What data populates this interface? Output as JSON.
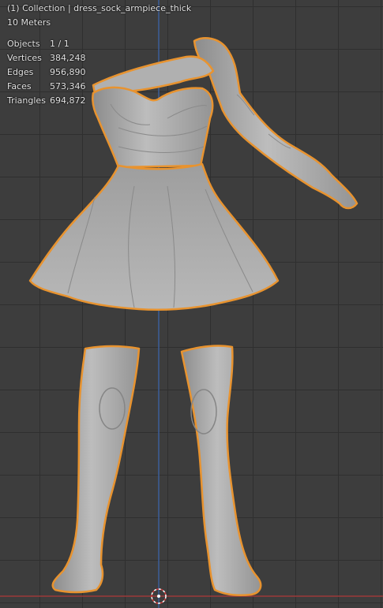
{
  "viewport": {
    "collection_label": "(1) Collection | dress_sock_armpiece_thick",
    "scale_label": "10 Meters"
  },
  "stats": [
    {
      "label": "Objects",
      "value": "1 / 1"
    },
    {
      "label": "Vertices",
      "value": "384,248"
    },
    {
      "label": "Edges",
      "value": "956,890"
    },
    {
      "label": "Faces",
      "value": "573,346"
    },
    {
      "label": "Triangles",
      "value": "694,872"
    }
  ],
  "colors": {
    "background": "#3d3d3d",
    "grid": "#2f2f2f",
    "selection_outline": "#e8932f",
    "mesh": "#a9a9a9",
    "x_axis": "#9b3a3a",
    "z_axis": "#3d5f9a"
  }
}
